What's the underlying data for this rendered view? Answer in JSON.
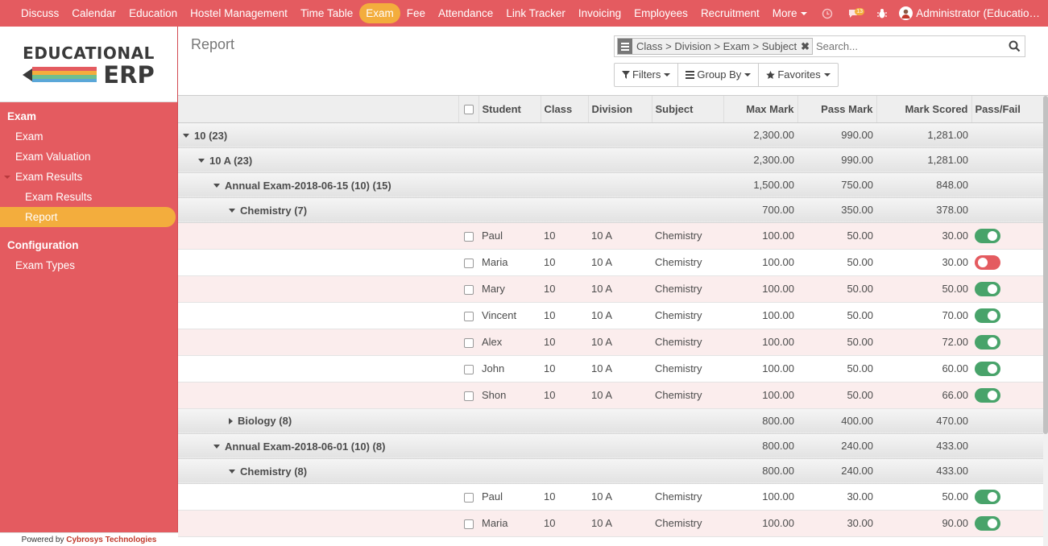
{
  "topbar": {
    "menu": [
      {
        "label": "Discuss",
        "active": false
      },
      {
        "label": "Calendar",
        "active": false
      },
      {
        "label": "Education",
        "active": false
      },
      {
        "label": "Hostel Management",
        "active": false
      },
      {
        "label": "Time Table",
        "active": false
      },
      {
        "label": "Exam",
        "active": true
      },
      {
        "label": "Fee",
        "active": false
      },
      {
        "label": "Attendance",
        "active": false
      },
      {
        "label": "Link Tracker",
        "active": false
      },
      {
        "label": "Invoicing",
        "active": false
      },
      {
        "label": "Employees",
        "active": false
      },
      {
        "label": "Recruitment",
        "active": false
      }
    ],
    "more_label": "More",
    "message_badge": "13",
    "user_name": "Administrator (Educatio…"
  },
  "sidebar": {
    "logo_top": "EDUCATIONAL",
    "logo_bottom": "ERP",
    "section_exam": "Exam",
    "items_exam": [
      {
        "label": "Exam",
        "sub": false,
        "active": false,
        "expander": false
      },
      {
        "label": "Exam Valuation",
        "sub": false,
        "active": false,
        "expander": false
      },
      {
        "label": "Exam Results",
        "sub": false,
        "active": false,
        "expander": true
      },
      {
        "label": "Exam Results",
        "sub": true,
        "active": false,
        "expander": false
      },
      {
        "label": "Report",
        "sub": true,
        "active": true,
        "expander": false
      }
    ],
    "section_config": "Configuration",
    "items_config": [
      {
        "label": "Exam Types"
      }
    ],
    "powered_prefix": "Powered by",
    "powered_brand": "Cybrosys Technologies"
  },
  "control": {
    "breadcrumb": "Report",
    "facet": "Class > Division > Exam > Subject",
    "search_placeholder": "Search...",
    "filters_label": "Filters",
    "groupby_label": "Group By",
    "favorites_label": "Favorites"
  },
  "table": {
    "headers": [
      "Student",
      "Class",
      "Division",
      "Subject",
      "Max Mark",
      "Pass Mark",
      "Mark Scored",
      "Pass/Fail"
    ],
    "rows": [
      {
        "type": "group",
        "level": 0,
        "open": true,
        "label": "10 (23)",
        "max": "2,300.00",
        "pass": "990.00",
        "scored": "1,281.00"
      },
      {
        "type": "group",
        "level": 1,
        "open": true,
        "label": "10 A (23)",
        "max": "2,300.00",
        "pass": "990.00",
        "scored": "1,281.00"
      },
      {
        "type": "group",
        "level": 2,
        "open": true,
        "label": "Annual Exam-2018-06-15 (10) (15)",
        "max": "1,500.00",
        "pass": "750.00",
        "scored": "848.00"
      },
      {
        "type": "group",
        "level": 3,
        "open": true,
        "label": "Chemistry (7)",
        "max": "700.00",
        "pass": "350.00",
        "scored": "378.00"
      },
      {
        "type": "record",
        "student": "Paul",
        "class": "10",
        "division": "10 A",
        "subject": "Chemistry",
        "max": "100.00",
        "pass": "50.00",
        "scored": "30.00",
        "passed": true
      },
      {
        "type": "record",
        "student": "Maria",
        "class": "10",
        "division": "10 A",
        "subject": "Chemistry",
        "max": "100.00",
        "pass": "50.00",
        "scored": "30.00",
        "passed": false
      },
      {
        "type": "record",
        "student": "Mary",
        "class": "10",
        "division": "10 A",
        "subject": "Chemistry",
        "max": "100.00",
        "pass": "50.00",
        "scored": "50.00",
        "passed": true
      },
      {
        "type": "record",
        "student": "Vincent",
        "class": "10",
        "division": "10 A",
        "subject": "Chemistry",
        "max": "100.00",
        "pass": "50.00",
        "scored": "70.00",
        "passed": true
      },
      {
        "type": "record",
        "student": "Alex",
        "class": "10",
        "division": "10 A",
        "subject": "Chemistry",
        "max": "100.00",
        "pass": "50.00",
        "scored": "72.00",
        "passed": true
      },
      {
        "type": "record",
        "student": "John",
        "class": "10",
        "division": "10 A",
        "subject": "Chemistry",
        "max": "100.00",
        "pass": "50.00",
        "scored": "60.00",
        "passed": true
      },
      {
        "type": "record",
        "student": "Shon",
        "class": "10",
        "division": "10 A",
        "subject": "Chemistry",
        "max": "100.00",
        "pass": "50.00",
        "scored": "66.00",
        "passed": true
      },
      {
        "type": "group",
        "level": 3,
        "open": false,
        "label": "Biology (8)",
        "max": "800.00",
        "pass": "400.00",
        "scored": "470.00"
      },
      {
        "type": "group",
        "level": 2,
        "open": true,
        "label": "Annual Exam-2018-06-01 (10) (8)",
        "max": "800.00",
        "pass": "240.00",
        "scored": "433.00"
      },
      {
        "type": "group",
        "level": 3,
        "open": true,
        "label": "Chemistry (8)",
        "max": "800.00",
        "pass": "240.00",
        "scored": "433.00"
      },
      {
        "type": "record",
        "student": "Paul",
        "class": "10",
        "division": "10 A",
        "subject": "Chemistry",
        "max": "100.00",
        "pass": "30.00",
        "scored": "50.00",
        "passed": true
      },
      {
        "type": "record",
        "student": "Maria",
        "class": "10",
        "division": "10 A",
        "subject": "Chemistry",
        "max": "100.00",
        "pass": "30.00",
        "scored": "90.00",
        "passed": true
      }
    ]
  },
  "colors": {
    "brand": "#e45b60",
    "active": "#f3ad3d",
    "pass": "#48a36a",
    "fail": "#e45b60"
  }
}
